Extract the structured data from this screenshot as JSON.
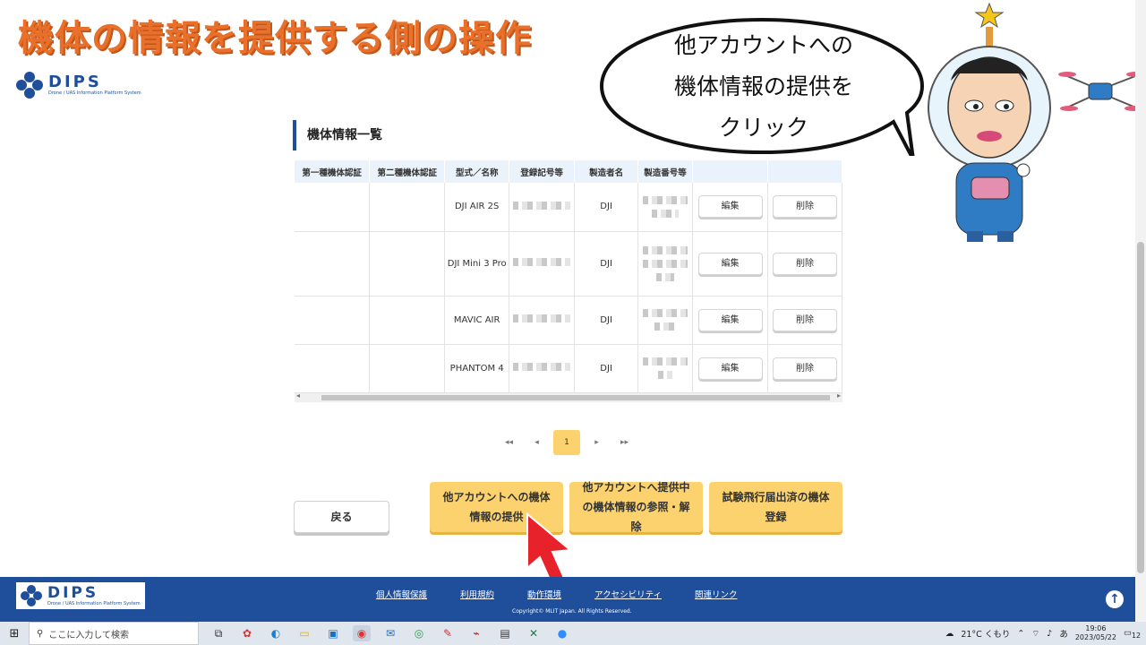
{
  "slide": {
    "title": "機体の情報を提供する側の操作",
    "callout_lines": [
      "他アカウントへの",
      "機体情報の提供を",
      "クリック"
    ]
  },
  "brand": {
    "name": "DIPS",
    "tagline": "Drone / UAS Information Platform System",
    "primary_color": "#1f4e9a",
    "accent_color": "#fbd26e"
  },
  "section": {
    "title": "機体情報一覧"
  },
  "table": {
    "headers": [
      "第一種機体認証",
      "第二種機体認証",
      "型式／名称",
      "登録記号等",
      "製造者名",
      "製造番号等",
      "",
      ""
    ],
    "rows": [
      {
        "model": "DJI AIR 2S",
        "maker": "DJI",
        "edit": "編集",
        "delete": "削除"
      },
      {
        "model": "DJI Mini 3 Pro",
        "maker": "DJI",
        "edit": "編集",
        "delete": "削除"
      },
      {
        "model": "MAVIC AIR",
        "maker": "DJI",
        "edit": "編集",
        "delete": "削除"
      },
      {
        "model": "PHANTOM 4",
        "maker": "DJI",
        "edit": "編集",
        "delete": "削除"
      }
    ]
  },
  "pagination": {
    "first": "◂◂",
    "prev": "◂",
    "current": "1",
    "next": "▸",
    "last": "▸▸"
  },
  "buttons": {
    "back": "戻る",
    "provide": "他アカウントへの機体情報の提供",
    "provided_list": "他アカウントへ提供中の機体情報の参照・解除",
    "register": "試験飛行届出済の機体登録"
  },
  "footer": {
    "links": [
      "個人情報保護",
      "利用規約",
      "動作環境",
      "アクセシビリティ",
      "関連リンク"
    ],
    "copyright": "Copyright© MLIT Japan. All Rights Reserved."
  },
  "taskbar": {
    "search_placeholder": "ここに入力して検索",
    "weather": "21°C くもり",
    "ime": "あ",
    "time": "19:06",
    "date": "2023/05/22",
    "notifications": "12"
  }
}
